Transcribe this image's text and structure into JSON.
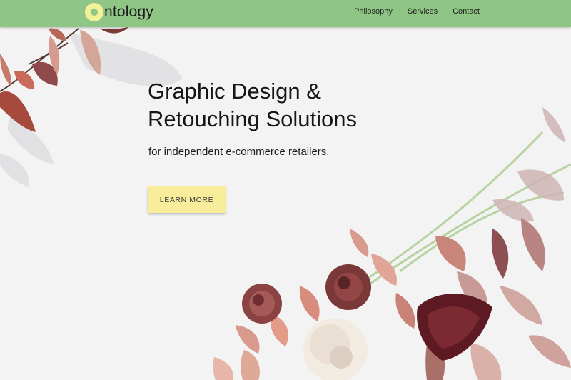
{
  "brand": {
    "logo_text": "ntology",
    "logo_icon": "circle-o-logo-icon"
  },
  "nav": {
    "items": [
      {
        "label": "Philosophy"
      },
      {
        "label": "Services"
      },
      {
        "label": "Contact"
      }
    ]
  },
  "hero": {
    "title_line1": "Graphic Design &",
    "title_line2": "Retouching Solutions",
    "subtitle": "for independent e-commerce retailers.",
    "cta_label": "LEARN MORE"
  },
  "colors": {
    "navbar": "#8fc585",
    "logo_accent": "#f0f19a",
    "cta_background": "#f7ed9a",
    "page_background": "#f3f3f4"
  }
}
